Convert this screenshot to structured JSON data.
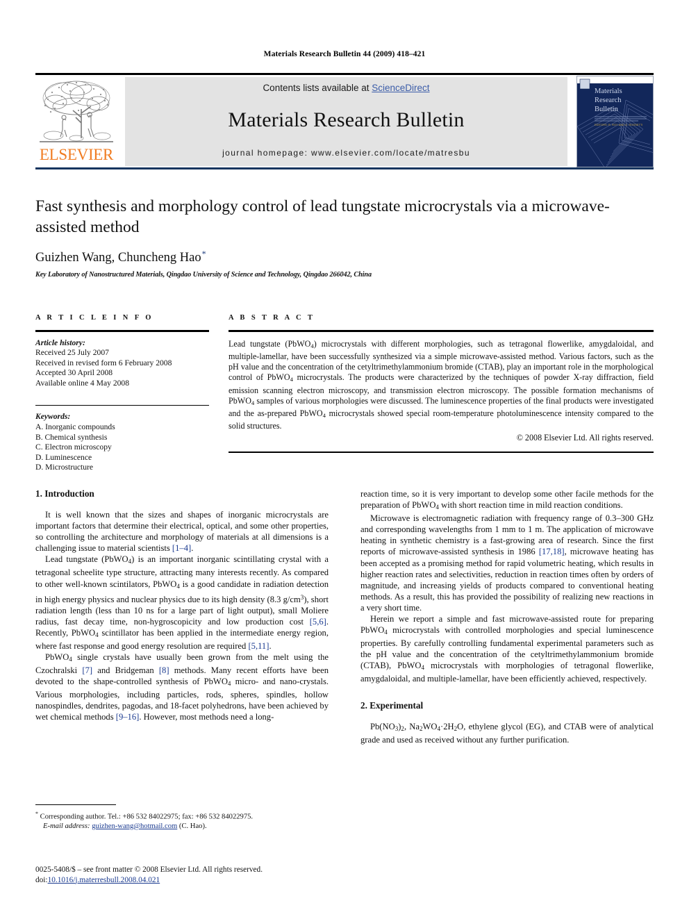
{
  "running_head": "Materials Research Bulletin 44 (2009) 418–421",
  "masthead": {
    "contents_prefix": "Contents lists available at ",
    "sciencedirect": "ScienceDirect",
    "journal_title": "Materials Research Bulletin",
    "homepage": "journal homepage: www.elsevier.com/locate/matresbu",
    "publisher_wordmark": "ELSEVIER",
    "cover_title_lines": [
      "Materials",
      "Research",
      "Bulletin"
    ],
    "link_color": "#3b5ca8",
    "band_color": "#e3e3e3",
    "elsevier_orange": "#f07c22",
    "cover_blue": "#12275a",
    "rule_blue": "#16355f"
  },
  "title_block": {
    "title": "Fast synthesis and morphology control of lead tungstate microcrystals via a microwave-assisted method",
    "authors": "Guizhen Wang, Chuncheng Hao",
    "corresponding_marker": "*",
    "affiliation": "Key Laboratory of Nanostructured Materials, Qingdao University of Science and Technology, Qingdao 266042, China"
  },
  "article_info": {
    "heading": "A R T I C L E   I N F O",
    "history_label": "Article history:",
    "history": [
      "Received 25 July 2007",
      "Received in revised form 6 February 2008",
      "Accepted 30 April 2008",
      "Available online 4 May 2008"
    ],
    "keywords_label": "Keywords:",
    "keywords": [
      "A. Inorganic compounds",
      "B. Chemical synthesis",
      "C. Electron microscopy",
      "D. Luminescence",
      "D. Microstructure"
    ]
  },
  "abstract": {
    "heading": "A B S T R A C T",
    "text_part1": "Lead tungstate (PbWO",
    "text_part2": ") microcrystals with different morphologies, such as tetragonal flowerlike, amygdaloidal, and multiple-lamellar, have been successfully synthesized via a simple microwave-assisted method. Various factors, such as the pH value and the concentration of the cetyltrimethylammonium bromide (CTAB), play an important role in the morphological control of PbWO",
    "text_part3": " microcrystals. The products were characterized by the techniques of powder X-ray diffraction, field emission scanning electron microscopy, and transmission electron microscopy. The possible formation mechanisms of PbWO",
    "text_part4": " samples of various morphologies were discussed. The luminescence properties of the final products were investigated and the as-prepared PbWO",
    "text_part5": " microcrystals showed special room-temperature photoluminescence intensity compared to the solid structures.",
    "copyright": "© 2008 Elsevier Ltd. All rights reserved."
  },
  "body": {
    "intro_heading": "1. Introduction",
    "experimental_heading": "2. Experimental",
    "p1_a": "It is well known that the sizes and shapes of inorganic microcrystals are important factors that determine their electrical, optical, and some other properties, so controlling the architecture and morphology of materials at all dimensions is a challenging issue to material scientists ",
    "p1_ref": "[1–4]",
    "p1_b": ".",
    "p2_a": "Lead tungstate (PbWO",
    "p2_b": ") is an important inorganic scintillating crystal with a tetragonal scheelite type structure, attracting many interests recently. As compared to other well-known scintilators, PbWO",
    "p2_c": " is a good candidate in radiation detection in high energy physics and nuclear physics due to its high density (8.3 g/cm",
    "p2_sup": "3",
    "p2_d": "), short radiation length (less than 10 ns for a large part of light output), small Moliere radius, fast decay time, non-hygroscopicity and low production cost ",
    "p2_ref1": "[5,6]",
    "p2_e": ". Recently, PbWO",
    "p2_f": " scintillator has been applied in the intermediate energy region, where fast response and good energy resolution are required ",
    "p2_ref2": "[5,11]",
    "p2_g": ".",
    "p3_a": "PbWO",
    "p3_b": " single crystals have usually been grown from the melt using the Czochralski ",
    "p3_ref1": "[7]",
    "p3_c": " and Bridgeman ",
    "p3_ref2": "[8]",
    "p3_d": " methods. Many recent efforts have been devoted to the shape-controlled synthesis of PbWO",
    "p3_e": " micro- and nano-crystals. Various morphologies, including particles, rods, spheres, spindles, hollow nanospindles, dendrites, pagodas, and 18-facet polyhedrons, have been achieved by wet chemical methods ",
    "p3_ref3": "[9–16]",
    "p3_f": ". However, most methods need a long-",
    "p4_a": "reaction time, so it is very important to develop some other facile methods for the preparation of PbWO",
    "p4_b": " with short reaction time in mild reaction conditions.",
    "p5_a": "Microwave is electromagnetic radiation with frequency range of 0.3–300 GHz and corresponding wavelengths from 1 mm to 1 m. The application of microwave heating in synthetic chemistry is a fast-growing area of research. Since the first reports of microwave-assisted synthesis in 1986 ",
    "p5_ref": "[17,18]",
    "p5_b": ", microwave heating has been accepted as a promising method for rapid volumetric heating, which results in higher reaction rates and selectivities, reduction in reaction times often by orders of magnitude, and increasing yields of products compared to conventional heating methods. As a result, this has provided the possibility of realizing new reactions in a very short time.",
    "p6_a": "Herein we report a simple and fast microwave-assisted route for preparing PbWO",
    "p6_b": " microcrystals with controlled morphologies and special luminescence properties. By carefully controlling fundamental experimental parameters such as the pH value and the concentration of the cetyltrimethylammonium bromide (CTAB), PbWO",
    "p6_c": " microcrystals with morphologies of tetragonal flowerlike, amygdaloidal, and multiple-lamellar, have been efficiently achieved, respectively.",
    "p7_a": "Pb(NO",
    "p7_sub1": "3",
    "p7_b": ")",
    "p7_sub2": "2",
    "p7_c": ", Na",
    "p7_sub3": "2",
    "p7_d": "WO",
    "p7_sub4": "4",
    "p7_e": "·2H",
    "p7_sub5": "2",
    "p7_f": "O, ethylene glycol (EG), and CTAB were of analytical grade and used as received without any further purification."
  },
  "footnote": {
    "marker": "*",
    "corresponding": " Corresponding author. Tel.: +86 532 84022975; fax: +86 532 84022975.",
    "email_label": "E-mail address:",
    "email": "guizhen-wang@hotmail.com",
    "email_suffix": " (C. Hao)."
  },
  "imprint": {
    "issn_line": "0025-5408/$ – see front matter © 2008 Elsevier Ltd. All rights reserved.",
    "doi_label": "doi:",
    "doi": "10.1016/j.materresbull.2008.04.021"
  }
}
